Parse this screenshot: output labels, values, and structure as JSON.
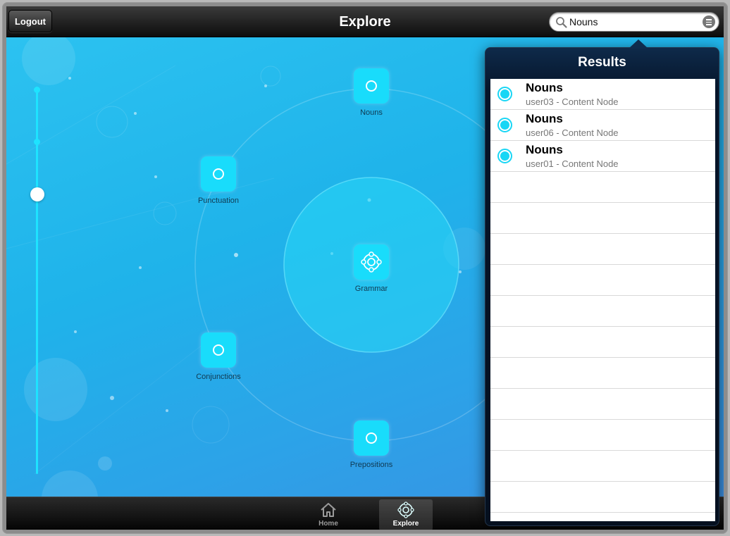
{
  "navbar": {
    "logout_label": "Logout",
    "title": "Explore",
    "search": {
      "value": "Nouns",
      "placeholder": ""
    }
  },
  "map": {
    "center_node": {
      "label": "Grammar"
    },
    "nodes": [
      {
        "label": "Nouns"
      },
      {
        "label": "Punctuation"
      },
      {
        "label": "Conjunctions"
      },
      {
        "label": "Prepositions"
      }
    ],
    "zoom_slider": {
      "level": 0.27
    }
  },
  "popover": {
    "title": "Results",
    "results": [
      {
        "title": "Nouns",
        "subtitle": "user03 - Content Node"
      },
      {
        "title": "Nouns",
        "subtitle": "user06 - Content Node"
      },
      {
        "title": "Nouns",
        "subtitle": "user01 - Content Node"
      }
    ]
  },
  "tabbar": {
    "tabs": [
      {
        "label": "Home",
        "icon": "home-icon",
        "active": false
      },
      {
        "label": "Explore",
        "icon": "explore-icon",
        "active": true
      }
    ]
  },
  "colors": {
    "accent": "#19dcfb",
    "map_bg": "#1fb3ea",
    "popover_bg": "#06152a"
  }
}
